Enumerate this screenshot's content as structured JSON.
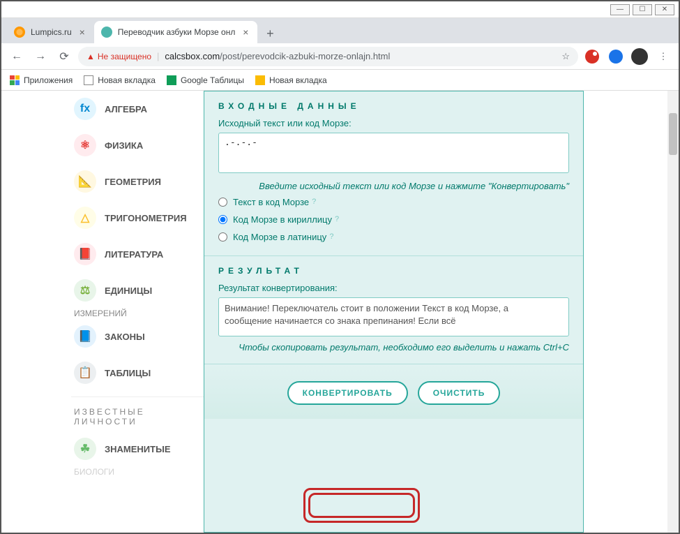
{
  "window": {
    "min": "—",
    "max": "☐",
    "close": "✕"
  },
  "tabs": [
    {
      "title": "Lumpics.ru",
      "active": false
    },
    {
      "title": "Переводчик азбуки Морзе онл",
      "active": true
    }
  ],
  "address": {
    "not_secure": "Не защищено",
    "url_host": "calcsbox.com",
    "url_path": "/post/perevodcik-azbuki-morze-onlajn.html"
  },
  "bookmarks": {
    "apps": "Приложения",
    "newtab1": "Новая вкладка",
    "sheets": "Google Таблицы",
    "newtab2": "Новая вкладка"
  },
  "sidebar": {
    "items": [
      {
        "label": "АЛГЕБРА"
      },
      {
        "label": "ФИЗИКА"
      },
      {
        "label": "ГЕОМЕТРИЯ"
      },
      {
        "label": "ТРИГОНОМЕТРИЯ"
      },
      {
        "label": "ЛИТЕРАТУРА"
      },
      {
        "label": "ЕДИНИЦЫ"
      },
      {
        "label_sub": "ИЗМЕРЕНИЙ"
      },
      {
        "label": "ЗАКОНЫ"
      },
      {
        "label": "ТАБЛИЦЫ"
      }
    ],
    "header2": "ИЗВЕСТНЫЕ ЛИЧНОСТИ",
    "famous": "ЗНАМЕНИТЫЕ",
    "famous_sub": "БИОЛОГИ"
  },
  "form": {
    "input_header": "ВХОДНЫЕ ДАННЫЕ",
    "input_label": "Исходный текст или код Морзе:",
    "input_value": ".-.-.-",
    "input_hint": "Введите исходный текст или код Морзе и нажмите \"Конвертировать\"",
    "radio1": "Текст в код Морзе",
    "radio2": "Код Морзе в кириллицу",
    "radio3": "Код Морзе в латиницу",
    "result_header": "РЕЗУЛЬТАТ",
    "result_label": "Результат конвертирования:",
    "result_value": "Внимание! Переключатель стоит в положении Текст в код Морзе, а сообщение начинается со знака препинания! Если всё",
    "result_hint": "Чтобы скопировать результат, необходимо его выделить и нажать Ctrl+C",
    "btn_convert": "КОНВЕРТИРОВАТЬ",
    "btn_clear": "ОЧИСТИТЬ"
  }
}
